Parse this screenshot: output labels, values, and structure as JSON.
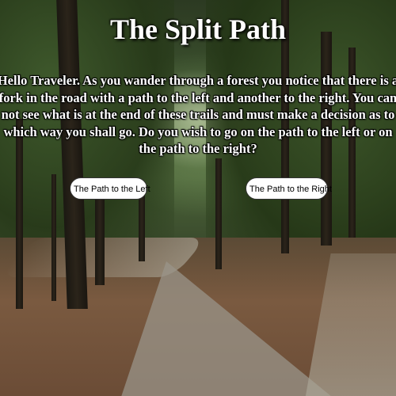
{
  "page": {
    "title": "The Split Path",
    "story": "Hello Traveler. As you wander through a forest you notice that there is a fork in the road with a path to the left and another to the right. You can not see what is at the end of these trails and must make a decision as to which way you shall go. Do you wish to go on the path to the left or on the path to the right?"
  },
  "choices": {
    "left_label": "The Path to the Left",
    "right_label": "The Path to the Right"
  },
  "colors": {
    "text": "#ffffff",
    "button_bg": "#ffffff",
    "button_text": "#000000"
  }
}
